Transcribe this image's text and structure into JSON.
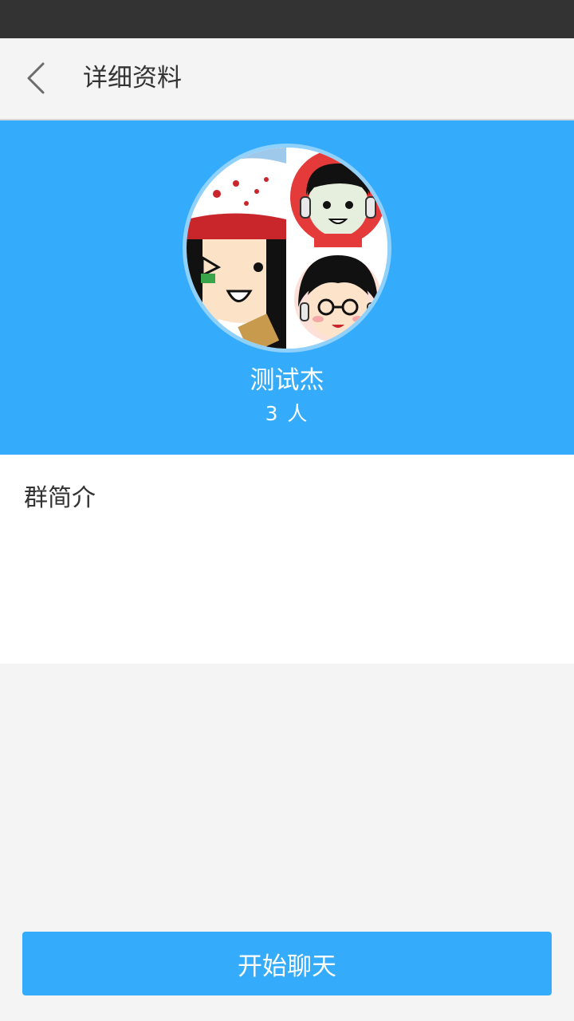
{
  "header": {
    "title": "详细资料",
    "back_icon": "chevron-left-icon"
  },
  "group": {
    "name": "测试杰",
    "member_count": "3 人",
    "avatar": "group-avatar-collage"
  },
  "intro": {
    "label": "群简介"
  },
  "footer": {
    "start_chat_label": "开始聊天"
  },
  "colors": {
    "accent": "#35abfb",
    "status_bar": "#333333",
    "background": "#f4f4f4"
  }
}
